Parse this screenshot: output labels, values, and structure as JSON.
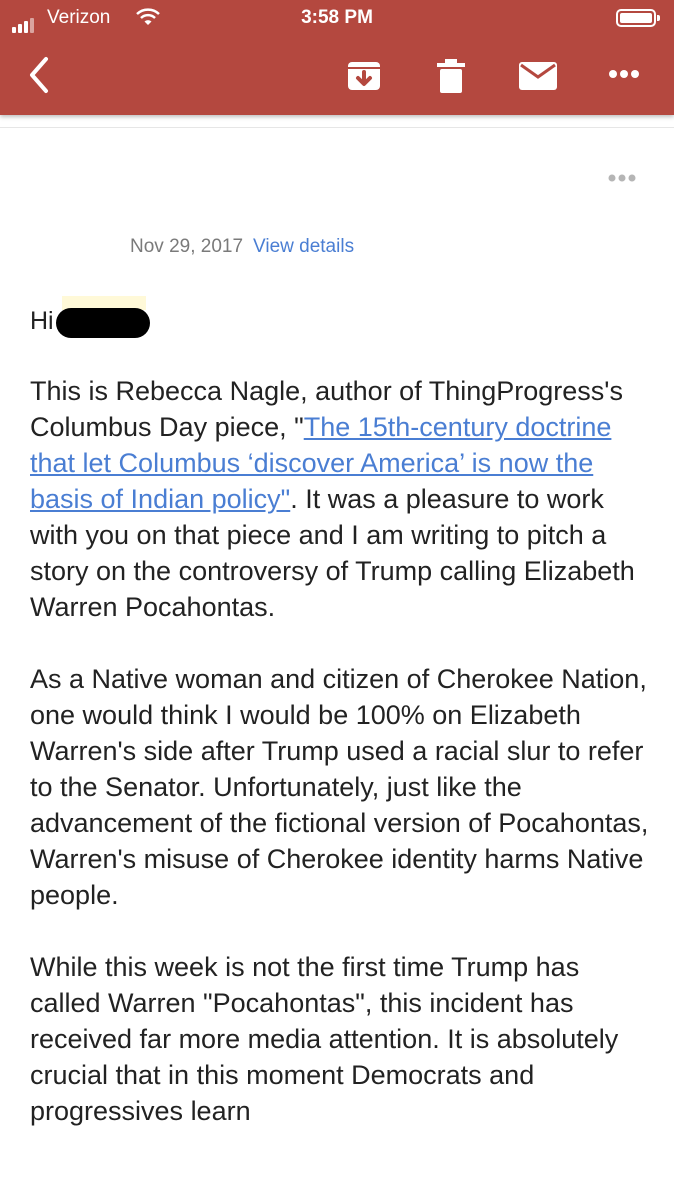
{
  "status_bar": {
    "carrier": "Verizon",
    "time": "3:58 PM",
    "icons": [
      "signal-bars-icon",
      "wifi-icon",
      "battery-icon"
    ]
  },
  "toolbar": {
    "icons": [
      "back-arrow-icon",
      "archive-icon",
      "trash-icon",
      "mail-icon",
      "more-dots-icon"
    ],
    "color": "#b4483f"
  },
  "message": {
    "date": "Nov 29, 2017",
    "view_details": "View details",
    "greeting": "Hi",
    "p1_before": "This is Rebecca Nagle, author of ThingProgress's Columbus Day piece, \"",
    "p1_link": "The 15th-century doctrine that let Columbus ‘discover America’ is now the basis of Indian policy\"",
    "p1_after": ". It was a pleasure to work with you on that piece and I am writing to pitch a story on the controversy of Trump calling Elizabeth Warren Pocahontas.",
    "p2": "As a Native woman and citizen of Cherokee Nation, one would think I would be 100% on Elizabeth Warren's side after Trump used a racial slur to refer to the Senator. Unfortunately, just like the advancement of the fictional version of Pocahontas, Warren's misuse of Cherokee identity harms Native people.",
    "p3": "While this week is not the first time Trump has called Warren \"Pocahontas\", this incident has received far more media attention. It is absolutely crucial that in this moment Democrats and progressives learn"
  },
  "colors": {
    "link": "#4a7ed3",
    "meta": "#7a7a7a"
  }
}
